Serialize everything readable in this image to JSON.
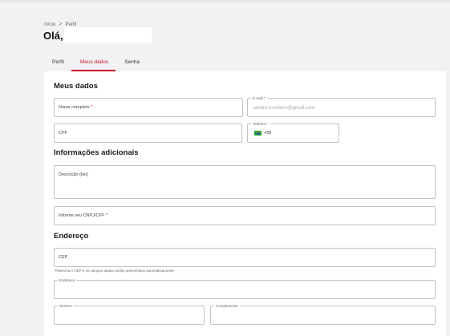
{
  "breadcrumb": {
    "home": "Início",
    "separator": ">",
    "current": "Perfil"
  },
  "greeting": "Olá,",
  "tabs": [
    {
      "label": "Perfil",
      "active": false
    },
    {
      "label": "Meus dados",
      "active": true
    },
    {
      "label": "Senha",
      "active": false
    }
  ],
  "sections": {
    "meus_dados": {
      "title": "Meus dados",
      "nome": {
        "placeholder": "Nome completo",
        "required_mark": "*"
      },
      "email": {
        "legend": "E-mail *",
        "value": "sandro.rcordeiro@gmail.com"
      },
      "cpf": {
        "placeholder": "CPF"
      },
      "telefone": {
        "legend": "Telefone *",
        "ddi": "+55",
        "flag": "brazil-flag-icon"
      }
    },
    "info": {
      "title": "Informações adicionais",
      "descricao": {
        "placeholder": "Descrição (bio)"
      },
      "cnpj": {
        "placeholder": "Informe seu CNPJ/CPF *"
      }
    },
    "endereco": {
      "title": "Endereço",
      "cep": {
        "placeholder": "CEP"
      },
      "helper": "Preencha o CEP e os campos abaixo serão preenchidos automaticamente",
      "endereco": {
        "legend": "Endereço"
      },
      "numero": {
        "legend": "Número"
      },
      "complemento": {
        "legend": "Complemento"
      }
    }
  },
  "colors": {
    "accent": "#c8102e",
    "page_bg": "#f2f2f2",
    "card_bg": "#ffffff",
    "border": "#c2c2c2"
  }
}
